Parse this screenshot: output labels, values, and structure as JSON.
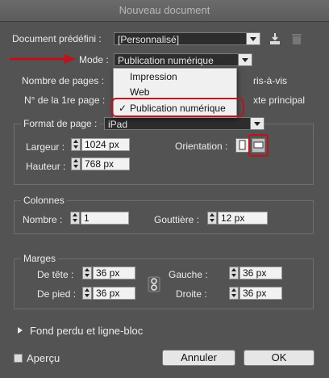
{
  "window": {
    "title": "Nouveau document"
  },
  "preset": {
    "label": "Document prédéfini :",
    "value": "[Personnalisé]"
  },
  "mode": {
    "label": "Mode :",
    "value": "Publication numérique",
    "options": [
      "Impression",
      "Web",
      "Publication numérique"
    ],
    "selected_mark": "✓"
  },
  "pages": {
    "label": "Nombre de pages :",
    "facing_suffix": "ris-à-vis"
  },
  "first_page": {
    "label": "N° de la 1re page :",
    "master_suffix": "xte principal"
  },
  "page_format": {
    "label": "Format de page :",
    "value": "iPad",
    "width_label": "Largeur :",
    "width_value": "1024 px",
    "height_label": "Hauteur :",
    "height_value": "768 px",
    "orientation_label": "Orientation :"
  },
  "columns": {
    "legend": "Colonnes",
    "number_label": "Nombre :",
    "number_value": "1",
    "gutter_label": "Gouttière :",
    "gutter_value": "12 px"
  },
  "margins": {
    "legend": "Marges",
    "top_label": "De tête :",
    "top_value": "36 px",
    "bottom_label": "De pied :",
    "bottom_value": "36 px",
    "left_label": "Gauche :",
    "left_value": "36 px",
    "right_label": "Droite :",
    "right_value": "36 px"
  },
  "bleed": {
    "label": "Fond perdu et ligne-bloc"
  },
  "preview": {
    "label": "Aperçu"
  },
  "buttons": {
    "cancel": "Annuler",
    "ok": "OK"
  },
  "colors": {
    "dialog_bg": "#535353",
    "annotation_red": "#c0121a",
    "menu_bg": "#f0f0f0"
  }
}
